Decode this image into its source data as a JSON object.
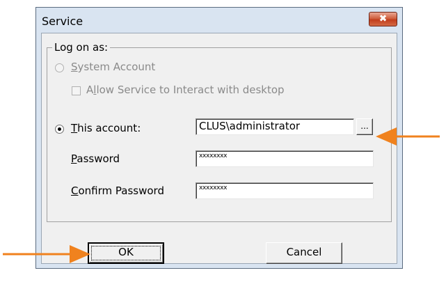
{
  "window": {
    "title": "Service",
    "close_glyph": "✖"
  },
  "group": {
    "legend": "Log on as:"
  },
  "system_account": {
    "label_first": "S",
    "label_rest": "ystem Account",
    "selected": false,
    "enabled": false
  },
  "interact_desktop": {
    "label_pre": "A",
    "label_u": "l",
    "label_rest": "low Service to Interact with desktop",
    "checked": false,
    "enabled": false
  },
  "this_account": {
    "label_first": "T",
    "label_rest": "his account:",
    "selected": true,
    "value": "CLUS\\administrator"
  },
  "browse_button": {
    "label": "..."
  },
  "password": {
    "label_first": "P",
    "label_rest": "assword",
    "value": "xxxxxxxx"
  },
  "confirm_password": {
    "label_first": "C",
    "label_rest": "onfirm Password",
    "value": "xxxxxxxx"
  },
  "ok_button": {
    "label": "OK"
  },
  "cancel_button": {
    "label": "Cancel"
  },
  "annotations": {
    "arrow_color": "#f0821e"
  }
}
